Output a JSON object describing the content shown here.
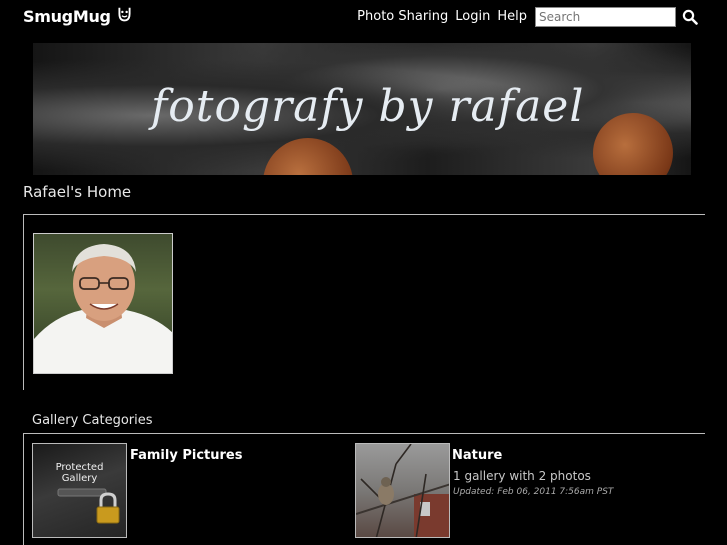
{
  "header": {
    "logo_text": "SmugMug",
    "nav": [
      "Photo Sharing",
      "Login",
      "Help"
    ],
    "search_placeholder": "Search"
  },
  "banner": {
    "title": "fotografy by rafael"
  },
  "home": {
    "title": "Rafael's Home"
  },
  "categories": {
    "heading": "Gallery Categories",
    "items": [
      {
        "name": "Family Pictures",
        "thumb_line1": "Protected",
        "thumb_line2": "Gallery",
        "info": "",
        "updated": ""
      },
      {
        "name": "Nature",
        "info": "1 gallery with 2 photos",
        "updated": "Updated: Feb 06, 2011 7:56am PST"
      }
    ]
  },
  "colors": {
    "background": "#000000",
    "text": "#ffffff",
    "muted": "#c8c8c8"
  }
}
